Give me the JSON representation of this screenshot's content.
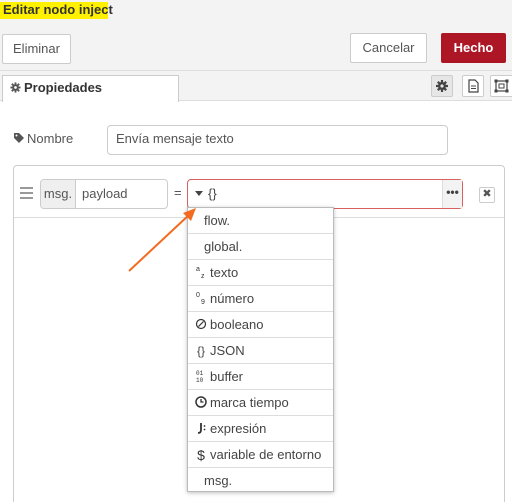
{
  "dialog": {
    "title": "Editar nodo inject"
  },
  "toolbar": {
    "delete_label": "Eliminar",
    "cancel_label": "Cancelar",
    "done_label": "Hecho"
  },
  "tabs": {
    "properties_label": "Propiedades"
  },
  "name_field": {
    "label": "Nombre",
    "value": "Envía mensaje texto"
  },
  "property": {
    "prefix": "msg.",
    "name": "payload",
    "equals": "=",
    "type_value": "{}",
    "more": "•••",
    "delete": "✖"
  },
  "type_menu": [
    {
      "label": "flow.",
      "icon": ""
    },
    {
      "label": "global.",
      "icon": ""
    },
    {
      "label": "texto",
      "icon": "string-icon"
    },
    {
      "label": "número",
      "icon": "number-icon"
    },
    {
      "label": "booleano",
      "icon": "boolean-icon"
    },
    {
      "label": "JSON",
      "icon": "json-icon"
    },
    {
      "label": "buffer",
      "icon": "buffer-icon"
    },
    {
      "label": "marca tiempo",
      "icon": "clock-icon"
    },
    {
      "label": "expresión",
      "icon": "jsonata-icon"
    },
    {
      "label": "variable de entorno",
      "icon": "dollar-icon"
    },
    {
      "label": "msg.",
      "icon": ""
    }
  ],
  "colors": {
    "accent": "#ad1625",
    "highlight": "#fff200",
    "arrow": "#f26b21"
  }
}
